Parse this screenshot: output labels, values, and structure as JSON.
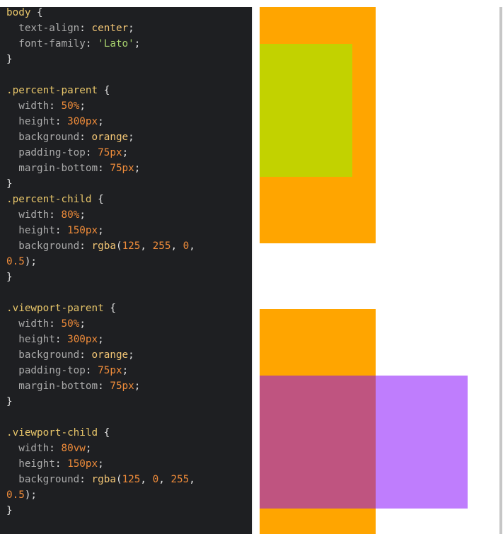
{
  "editor": {
    "lines": [
      [
        {
          "t": "sel",
          "v": "body"
        },
        {
          "t": "punc",
          "v": " {"
        }
      ],
      [
        {
          "t": "prop",
          "v": "  text-align"
        },
        {
          "t": "punc",
          "v": ": "
        },
        {
          "t": "word",
          "v": "center"
        },
        {
          "t": "punc",
          "v": ";"
        }
      ],
      [
        {
          "t": "prop",
          "v": "  font-family"
        },
        {
          "t": "punc",
          "v": ": "
        },
        {
          "t": "str",
          "v": "'Lato'"
        },
        {
          "t": "punc",
          "v": ";"
        }
      ],
      [
        {
          "t": "punc",
          "v": "}"
        }
      ],
      [],
      [
        {
          "t": "sel",
          "v": ".percent-parent"
        },
        {
          "t": "punc",
          "v": " {"
        }
      ],
      [
        {
          "t": "prop",
          "v": "  width"
        },
        {
          "t": "punc",
          "v": ": "
        },
        {
          "t": "num",
          "v": "50%"
        },
        {
          "t": "punc",
          "v": ";"
        }
      ],
      [
        {
          "t": "prop",
          "v": "  height"
        },
        {
          "t": "punc",
          "v": ": "
        },
        {
          "t": "num",
          "v": "300px"
        },
        {
          "t": "punc",
          "v": ";"
        }
      ],
      [
        {
          "t": "prop",
          "v": "  background"
        },
        {
          "t": "punc",
          "v": ": "
        },
        {
          "t": "word",
          "v": "orange"
        },
        {
          "t": "punc",
          "v": ";"
        }
      ],
      [
        {
          "t": "prop",
          "v": "  padding-top"
        },
        {
          "t": "punc",
          "v": ": "
        },
        {
          "t": "num",
          "v": "75px"
        },
        {
          "t": "punc",
          "v": ";"
        }
      ],
      [
        {
          "t": "prop",
          "v": "  margin-bottom"
        },
        {
          "t": "punc",
          "v": ": "
        },
        {
          "t": "num",
          "v": "75px"
        },
        {
          "t": "punc",
          "v": ";"
        }
      ],
      [
        {
          "t": "punc",
          "v": "}"
        }
      ],
      [
        {
          "t": "sel",
          "v": ".percent-child"
        },
        {
          "t": "punc",
          "v": " {"
        }
      ],
      [
        {
          "t": "prop",
          "v": "  width"
        },
        {
          "t": "punc",
          "v": ": "
        },
        {
          "t": "num",
          "v": "80%"
        },
        {
          "t": "punc",
          "v": ";"
        }
      ],
      [
        {
          "t": "prop",
          "v": "  height"
        },
        {
          "t": "punc",
          "v": ": "
        },
        {
          "t": "num",
          "v": "150px"
        },
        {
          "t": "punc",
          "v": ";"
        }
      ],
      [
        {
          "t": "prop",
          "v": "  background"
        },
        {
          "t": "punc",
          "v": ": "
        },
        {
          "t": "fn",
          "v": "rgba"
        },
        {
          "t": "punc",
          "v": "("
        },
        {
          "t": "num",
          "v": "125"
        },
        {
          "t": "punc",
          "v": ", "
        },
        {
          "t": "num",
          "v": "255"
        },
        {
          "t": "punc",
          "v": ", "
        },
        {
          "t": "num",
          "v": "0"
        },
        {
          "t": "punc",
          "v": ","
        }
      ],
      [
        {
          "t": "num",
          "v": "0.5"
        },
        {
          "t": "punc",
          "v": ");"
        }
      ],
      [
        {
          "t": "punc",
          "v": "}"
        }
      ],
      [],
      [
        {
          "t": "sel",
          "v": ".viewport-parent"
        },
        {
          "t": "punc",
          "v": " {"
        }
      ],
      [
        {
          "t": "prop",
          "v": "  width"
        },
        {
          "t": "punc",
          "v": ": "
        },
        {
          "t": "num",
          "v": "50%"
        },
        {
          "t": "punc",
          "v": ";"
        }
      ],
      [
        {
          "t": "prop",
          "v": "  height"
        },
        {
          "t": "punc",
          "v": ": "
        },
        {
          "t": "num",
          "v": "300px"
        },
        {
          "t": "punc",
          "v": ";"
        }
      ],
      [
        {
          "t": "prop",
          "v": "  background"
        },
        {
          "t": "punc",
          "v": ": "
        },
        {
          "t": "word",
          "v": "orange"
        },
        {
          "t": "punc",
          "v": ";"
        }
      ],
      [
        {
          "t": "prop",
          "v": "  padding-top"
        },
        {
          "t": "punc",
          "v": ": "
        },
        {
          "t": "num",
          "v": "75px"
        },
        {
          "t": "punc",
          "v": ";"
        }
      ],
      [
        {
          "t": "prop",
          "v": "  margin-bottom"
        },
        {
          "t": "punc",
          "v": ": "
        },
        {
          "t": "num",
          "v": "75px"
        },
        {
          "t": "punc",
          "v": ";"
        }
      ],
      [
        {
          "t": "punc",
          "v": "}"
        }
      ],
      [],
      [
        {
          "t": "sel",
          "v": ".viewport-child"
        },
        {
          "t": "punc",
          "v": " {"
        }
      ],
      [
        {
          "t": "prop",
          "v": "  width"
        },
        {
          "t": "punc",
          "v": ": "
        },
        {
          "t": "num",
          "v": "80vw"
        },
        {
          "t": "punc",
          "v": ";"
        }
      ],
      [
        {
          "t": "prop",
          "v": "  height"
        },
        {
          "t": "punc",
          "v": ": "
        },
        {
          "t": "num",
          "v": "150px"
        },
        {
          "t": "punc",
          "v": ";"
        }
      ],
      [
        {
          "t": "prop",
          "v": "  background"
        },
        {
          "t": "punc",
          "v": ": "
        },
        {
          "t": "fn",
          "v": "rgba"
        },
        {
          "t": "punc",
          "v": "("
        },
        {
          "t": "num",
          "v": "125"
        },
        {
          "t": "punc",
          "v": ", "
        },
        {
          "t": "num",
          "v": "0"
        },
        {
          "t": "punc",
          "v": ", "
        },
        {
          "t": "num",
          "v": "255"
        },
        {
          "t": "punc",
          "v": ","
        }
      ],
      [
        {
          "t": "num",
          "v": "0.5"
        },
        {
          "t": "punc",
          "v": ");"
        }
      ],
      [
        {
          "t": "punc",
          "v": "}"
        }
      ]
    ]
  },
  "preview": {
    "percent_parent_color": "#ffa500",
    "percent_child_color": "#c2d200",
    "viewport_parent_color": "#ffa500",
    "viewport_child_overlap_color": "#bf5480",
    "viewport_child_color": "#bf7dfd"
  }
}
